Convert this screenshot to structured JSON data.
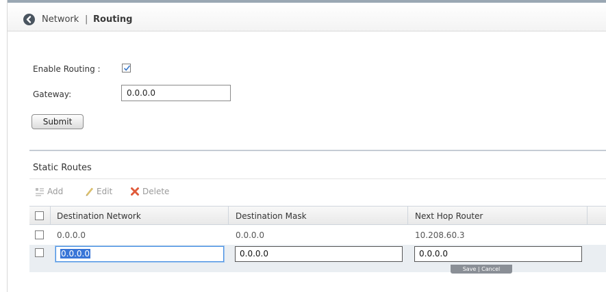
{
  "header": {
    "breadcrumb_parent": "Network",
    "separator": "|",
    "title": "Routing"
  },
  "form": {
    "enable_routing_label": "Enable Routing :",
    "enable_routing_checked": true,
    "gateway_label": "Gateway:",
    "gateway_value": "0.0.0.0",
    "submit_label": "Submit"
  },
  "static_routes": {
    "title": "Static Routes",
    "toolbar": {
      "add_label": "Add",
      "edit_label": "Edit",
      "delete_label": "Delete"
    },
    "columns": [
      "Destination Network",
      "Destination Mask",
      "Next Hop Router"
    ],
    "rows": [
      {
        "destination_network": "0.0.0.0",
        "destination_mask": "0.0.0.0",
        "next_hop_router": "10.208.60.3"
      }
    ],
    "editing_row": {
      "destination_network": "0.0.0.0",
      "destination_mask": "0.0.0.0",
      "next_hop_router": "0.0.0.0"
    },
    "row_editor": {
      "save_label": "Save",
      "separator": "|",
      "cancel_label": "Cancel"
    }
  },
  "colors": {
    "header_top_border": "#9aa7b3",
    "back_button": "#4a5560",
    "focus_border": "#4a90e2",
    "selection": "#3875d7",
    "delete_icon": "#e05a3a",
    "edit_icon": "#d4b24a"
  }
}
